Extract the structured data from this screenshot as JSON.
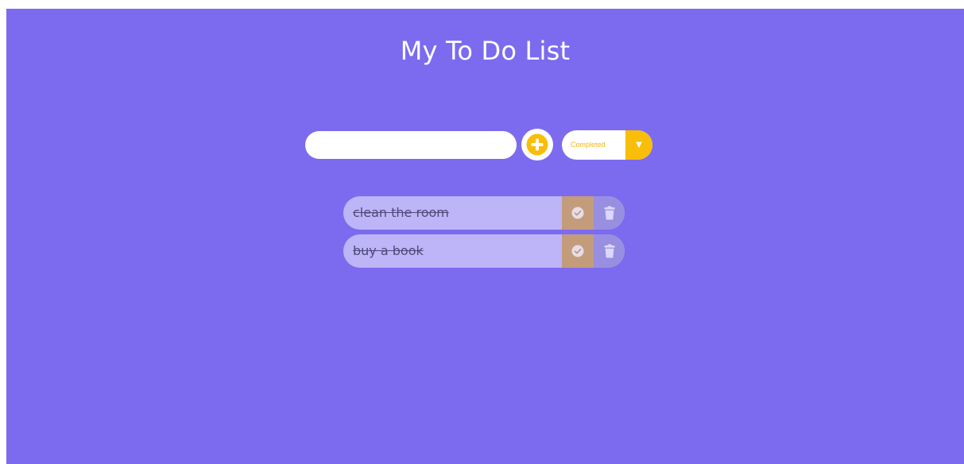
{
  "header": {
    "title": "My To Do List"
  },
  "form": {
    "input_value": "",
    "input_placeholder": "",
    "add_icon": "plus-circle-icon",
    "filter_selected": "Completed",
    "filter_arrow": "▼",
    "filter_arrow_icon": "chevron-down-icon"
  },
  "todos": [
    {
      "text": "clean the room",
      "completed": true
    },
    {
      "text": "buy a book",
      "completed": true
    }
  ],
  "icons": {
    "complete": "check-circle-icon",
    "delete": "trash-icon"
  },
  "colors": {
    "background": "#7c6bef",
    "accent": "#f8be09",
    "item_background": "#bdb5f7",
    "complete_button": "#c39c7c",
    "trash_button": "#988fe0",
    "completed_text": "#4e4a7a"
  }
}
